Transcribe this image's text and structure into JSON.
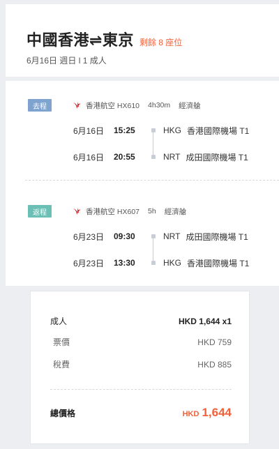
{
  "header": {
    "route": "中國香港⇌東京",
    "seats_left": "剩餘 8 座位",
    "subtitle": "6月16日 週日 l 1 成人"
  },
  "outbound": {
    "badge": "去程",
    "airline": "香港航空 HX610",
    "duration": "4h30m",
    "cabin": "經濟艙",
    "departure": {
      "date": "6月16日",
      "time": "15:25",
      "code": "HKG",
      "airport": "香港國際機場 T1"
    },
    "arrival": {
      "date": "6月16日",
      "time": "20:55",
      "code": "NRT",
      "airport": "成田國際機場 T1"
    }
  },
  "return": {
    "badge": "返程",
    "airline": "香港航空 HX607",
    "duration": "5h",
    "cabin": "經濟艙",
    "departure": {
      "date": "6月23日",
      "time": "09:30",
      "code": "NRT",
      "airport": "成田國際機場 T1"
    },
    "arrival": {
      "date": "6月23日",
      "time": "13:30",
      "code": "HKG",
      "airport": "香港國際機場 T1"
    }
  },
  "price": {
    "adult_label": "成人",
    "adult_amount": "HKD 1,644 x1",
    "fare_label": "票價",
    "fare_amount": "HKD 759",
    "tax_label": "稅費",
    "tax_amount": "HKD 885",
    "total_label": "總價格",
    "total_currency": "HKD",
    "total_amount": "1,644"
  },
  "colors": {
    "accent": "#f2603a",
    "outbound_badge": "#7fa3cf",
    "return_badge": "#6cbfb4",
    "airline_logo": "#d9242c"
  },
  "icons": {
    "airline_logo": "hong-kong-airlines-logo-icon"
  }
}
